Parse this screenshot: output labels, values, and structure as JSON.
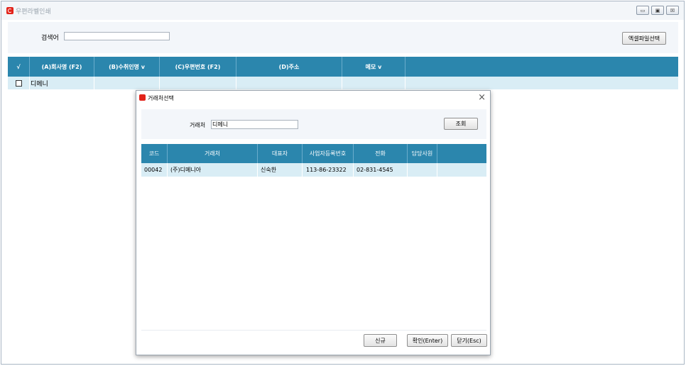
{
  "window": {
    "title": "우편라벨인쇄",
    "buttons": {
      "minimize": "▭",
      "restore": "▣",
      "close": "☒"
    }
  },
  "search": {
    "label": "검색어",
    "value": "",
    "excel_button": "엑셀파일선택"
  },
  "main_grid": {
    "headers": [
      "√",
      "(A)회사명 (F2)",
      "(B)수취인명 v",
      "(C)우편번호 (F2)",
      "(D)주소",
      "메모 v",
      ""
    ],
    "rows": [
      {
        "company": "디메니",
        "recipient": "",
        "zip": "",
        "address": "",
        "memo": ""
      }
    ]
  },
  "dialog": {
    "title": "거래처선택",
    "close_icon": "×",
    "search_label": "거래처",
    "search_value": "디메니",
    "query_button": "조회",
    "headers": [
      "코드",
      "거래처",
      "대표자",
      "사업자등록번호",
      "전화",
      "담당사원",
      ""
    ],
    "rows": [
      {
        "code": "00042",
        "name": "(주)디메니아",
        "rep": "신숙한",
        "bizno": "113-86-23322",
        "phone": "02-831-4545",
        "staff": ""
      }
    ],
    "buttons": {
      "new": "신규",
      "confirm": "확인(Enter)",
      "close": "닫기(Esc)"
    }
  },
  "colors": {
    "header_bg": "#2b86ad",
    "row_bg": "#d9edf5",
    "panel_bg": "#f3f6fa",
    "icon_red": "#e2231a"
  },
  "icons": {
    "app": "app-logo-icon",
    "dialog": "app-logo-icon",
    "close": "close-icon"
  }
}
